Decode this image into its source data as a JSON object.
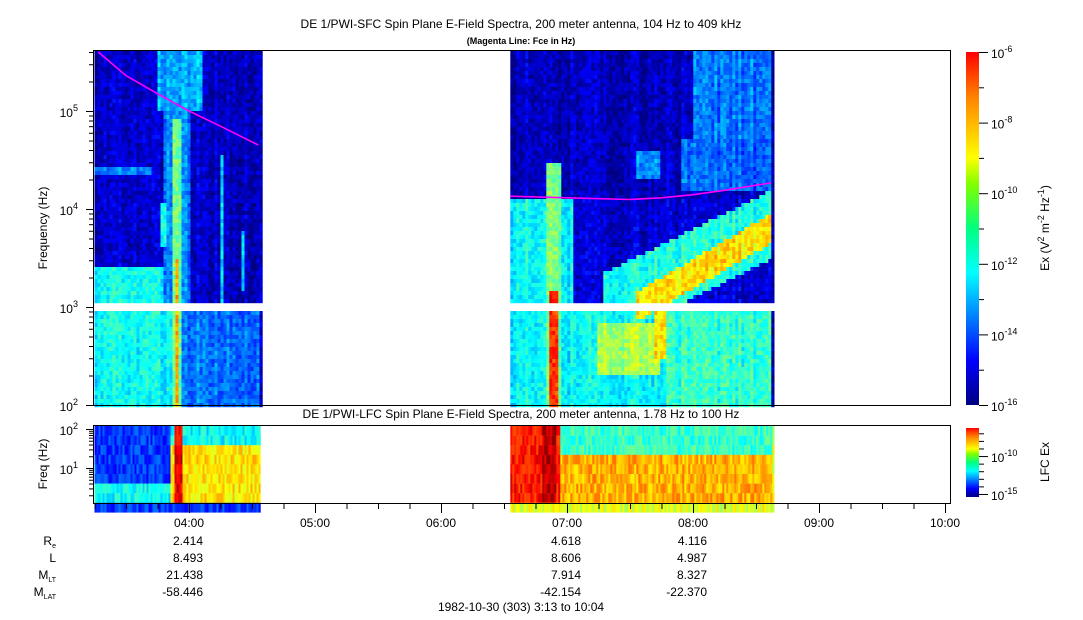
{
  "chart_data": [
    {
      "type": "heatmap",
      "name": "sfc",
      "title": "DE 1/PWI-SFC  Spin Plane E-Field Spectra, 200 meter antenna, 104 Hz to 409 kHz",
      "subtitle": "(Magenta Line: Fce in Hz)",
      "ylabel": "Frequency (Hz)",
      "yscale": "log",
      "ylim": [
        100,
        409000
      ],
      "y_ticks": [
        {
          "value": 100,
          "exp": "2"
        },
        {
          "value": 1000,
          "exp": "3"
        },
        {
          "value": 10000,
          "exp": "4"
        },
        {
          "value": 100000,
          "exp": "5"
        }
      ],
      "data_gap_hz": [
        900,
        1060
      ],
      "colorbar": {
        "label_pre": "Ex (V",
        "label_sup1": "2",
        "label_mid": " m",
        "label_sup2": "-2",
        "label_mid2": " Hz",
        "label_sup3": "-1",
        "label_post": ")",
        "range_log10": [
          -16,
          -6
        ],
        "ticks": [
          {
            "value": -6,
            "exp": "-6"
          },
          {
            "value": -8,
            "exp": "-8"
          },
          {
            "value": -10,
            "exp": "-10"
          },
          {
            "value": -12,
            "exp": "-12"
          },
          {
            "value": -14,
            "exp": "-14"
          },
          {
            "value": -16,
            "exp": "-16"
          }
        ]
      },
      "blocks": [
        {
          "time_range": [
            3.25,
            4.567
          ],
          "base_log10": -15.3,
          "features": [
            {
              "t": [
                3.25,
                3.9
              ],
              "f": [
                100,
                2500
              ],
              "v": -12.2
            },
            {
              "t": [
                3.9,
                4.567
              ],
              "f": [
                100,
                1000
              ],
              "v": -13.6
            },
            {
              "t": [
                3.75,
                4.1
              ],
              "f": [
                100000,
                409000
              ],
              "v": -13.0
            },
            {
              "t": [
                3.8,
                4.0
              ],
              "f": [
                1000,
                100000
              ],
              "v": -13.4
            },
            {
              "t": [
                3.88,
                3.94
              ],
              "f": [
                100,
                80000
              ],
              "v": -11.0
            },
            {
              "t": [
                3.9,
                3.925
              ],
              "f": [
                100,
                3000
              ],
              "v": -8.8
            },
            {
              "t": [
                3.78,
                3.83
              ],
              "f": [
                4000,
                12000
              ],
              "v": -11.8
            },
            {
              "t": [
                4.25,
                4.28
              ],
              "f": [
                1000,
                35000
              ],
              "v": -12.5
            },
            {
              "t": [
                4.42,
                4.45
              ],
              "f": [
                1500,
                6000
              ],
              "v": -12.5
            },
            {
              "t": [
                3.25,
                3.7
              ],
              "f": [
                23000,
                26000
              ],
              "v": -13.5
            }
          ]
        },
        {
          "time_range": [
            6.55,
            8.633
          ],
          "base_log10": -15.4,
          "features": [
            {
              "t": [
                6.55,
                8.633
              ],
              "f": [
                100,
                13000
              ],
              "v": -12.3
            },
            {
              "t": [
                7.05,
                8.633
              ],
              "f": [
                1000,
                12500
              ],
              "v": -15.2
            },
            {
              "band": true,
              "from": [
                7.3,
                1000
              ],
              "to": [
                8.633,
                7000
              ],
              "width_dec": 0.35,
              "v": -12.0
            },
            {
              "band": true,
              "from": [
                7.55,
                1000
              ],
              "to": [
                8.633,
                6500
              ],
              "width_dec": 0.15,
              "v": -9.5
            },
            {
              "t": [
                6.83,
                6.95
              ],
              "f": [
                100,
                30000
              ],
              "v": -11.0
            },
            {
              "t": [
                6.86,
                6.92
              ],
              "f": [
                100,
                1500
              ],
              "v": -7.8
            },
            {
              "t": [
                7.25,
                7.75
              ],
              "f": [
                200,
                700
              ],
              "v": -10.5
            },
            {
              "t": [
                7.7,
                7.8
              ],
              "f": [
                300,
                1000
              ],
              "v": -9.5
            },
            {
              "t": [
                7.8,
                8.633
              ],
              "f": [
                100,
                1000
              ],
              "v": -11.8
            },
            {
              "t": [
                7.55,
                7.75
              ],
              "f": [
                20000,
                40000
              ],
              "v": -13.3
            },
            {
              "t": [
                7.9,
                8.633
              ],
              "f": [
                15000,
                50000
              ],
              "v": -13.8
            },
            {
              "t": [
                8.0,
                8.633
              ],
              "f": [
                50000,
                409000
              ],
              "v": -13.6
            }
          ]
        }
      ],
      "fce_line": {
        "color": "#ff00ff",
        "segments": [
          [
            [
              3.28,
              400000
            ],
            [
              3.5,
              230000
            ],
            [
              3.75,
              150000
            ],
            [
              4.0,
              100000
            ],
            [
              4.25,
              70000
            ],
            [
              4.55,
              45000
            ]
          ],
          [
            [
              6.55,
              13500
            ],
            [
              7.0,
              13000
            ],
            [
              7.5,
              12500
            ],
            [
              7.75,
              13000
            ],
            [
              8.0,
              14000
            ],
            [
              8.25,
              15500
            ],
            [
              8.62,
              18500
            ]
          ]
        ]
      }
    },
    {
      "type": "heatmap",
      "name": "lfc",
      "title": "DE 1/PWI-LFC  Spin Plane E-Field Spectra, 200 meter antenna, 1.78 Hz to 100 Hz",
      "ylabel": "Freq (Hz)",
      "yscale": "log",
      "ylim": [
        1.27,
        100
      ],
      "y_ticks": [
        {
          "value": 10,
          "exp": "1"
        },
        {
          "value": 100,
          "exp": "2"
        }
      ],
      "colorbar": {
        "label": "LFC Ex",
        "range_log10": [
          -15.4,
          -6.3
        ],
        "ticks": [
          {
            "value": -10,
            "exp": "-10"
          },
          {
            "value": -15,
            "exp": "-15"
          }
        ]
      },
      "blocks": [
        {
          "time_range": [
            3.25,
            4.567
          ],
          "base_log10": -13.8,
          "features": [
            {
              "t": [
                3.25,
                3.85
              ],
              "f": [
                1.2,
                3
              ],
              "v": -12.0
            },
            {
              "t": [
                3.85,
                4.567
              ],
              "f": [
                1.2,
                30
              ],
              "v": -9.5
            },
            {
              "t": [
                3.85,
                4.567
              ],
              "f": [
                30,
                100
              ],
              "v": -12.0
            },
            {
              "t": [
                3.88,
                3.95
              ],
              "f": [
                1.2,
                100
              ],
              "v": -7.3
            }
          ]
        },
        {
          "time_range": [
            6.55,
            8.633
          ],
          "base_log10": -10.0,
          "features": [
            {
              "t": [
                6.55,
                6.95
              ],
              "f": [
                1.2,
                100
              ],
              "v": -7.6
            },
            {
              "t": [
                6.95,
                8.633
              ],
              "f": [
                1.2,
                20
              ],
              "v": -9.0
            },
            {
              "t": [
                6.95,
                8.633
              ],
              "f": [
                20,
                100
              ],
              "v": -11.5
            },
            {
              "t": [
                6.8,
                6.92
              ],
              "f": [
                1.2,
                100
              ],
              "v": -6.8
            }
          ]
        }
      ]
    }
  ],
  "x_axis": {
    "range_hours": [
      3.2167,
      10.0667
    ],
    "ticks": [
      {
        "value": 4,
        "label": "04:00"
      },
      {
        "value": 5,
        "label": "05:00"
      },
      {
        "value": 6,
        "label": "06:00"
      },
      {
        "value": 7,
        "label": "07:00"
      },
      {
        "value": 8,
        "label": "08:00"
      },
      {
        "value": 9,
        "label": "09:00"
      },
      {
        "value": 10,
        "label": "10:00"
      }
    ]
  },
  "orbit": {
    "rows": [
      {
        "label": "R",
        "sub": "e",
        "values": [
          "2.414",
          "4.618",
          "4.116"
        ]
      },
      {
        "label": "L",
        "sub": "",
        "values": [
          "8.493",
          "8.606",
          "4.987"
        ]
      },
      {
        "label": "M",
        "sub": "LT",
        "values": [
          "21.438",
          "7.914",
          "8.327"
        ]
      },
      {
        "label": "M",
        "sub": "LAT",
        "values": [
          "-58.446",
          "-42.154",
          "-22.370"
        ]
      }
    ],
    "at_hours": [
      4,
      7,
      8
    ]
  },
  "footer": "1982-10-30 (303) 3:13 to 10:04"
}
